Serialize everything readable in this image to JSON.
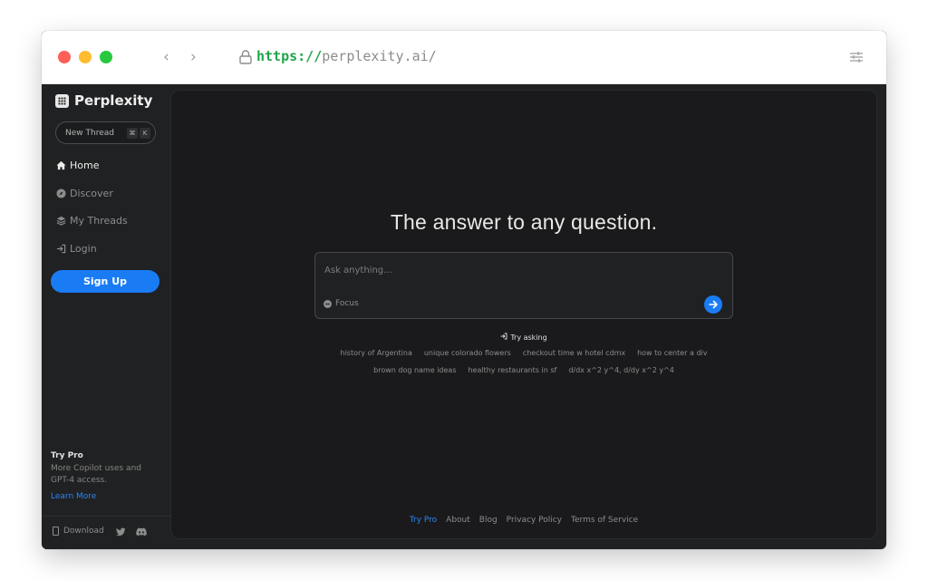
{
  "browser": {
    "url_scheme": "https://",
    "url_host": "perplexity.ai/"
  },
  "sidebar": {
    "brand": "Perplexity",
    "new_thread": {
      "label": "New Thread",
      "shortcut_mod": "⌘",
      "shortcut_key": "K"
    },
    "nav": [
      {
        "label": "Home",
        "icon": "home-icon",
        "active": true
      },
      {
        "label": "Discover",
        "icon": "compass-icon",
        "active": false
      },
      {
        "label": "My Threads",
        "icon": "layers-icon",
        "active": false
      },
      {
        "label": "Login",
        "icon": "login-icon",
        "active": false
      }
    ],
    "signup": "Sign Up",
    "try_pro": {
      "title": "Try Pro",
      "description": "More Copilot uses and GPT-4 access.",
      "link": "Learn More"
    },
    "footer": {
      "download": "Download",
      "icons": [
        "twitter-icon",
        "discord-icon"
      ]
    }
  },
  "main": {
    "headline": "The answer to any question.",
    "ask": {
      "placeholder": "Ask anything...",
      "focus_label": "Focus"
    },
    "try_asking": "Try asking",
    "suggestions_row1": [
      "history of Argentina",
      "unique colorado flowers",
      "checkout time w hotel cdmx",
      "how to center a div"
    ],
    "suggestions_row2": [
      "brown dog name ideas",
      "healthy restaurants in sf",
      "d/dx x^2 y^4, d/dy x^2 y^4"
    ],
    "footer_links": [
      "Try Pro",
      "About",
      "Blog",
      "Privacy Policy",
      "Terms of Service"
    ]
  },
  "colors": {
    "accent": "#1a7cf5",
    "sidebar_bg": "#202123",
    "main_bg": "#1a1a1c",
    "url_scheme": "#1ea64a"
  }
}
